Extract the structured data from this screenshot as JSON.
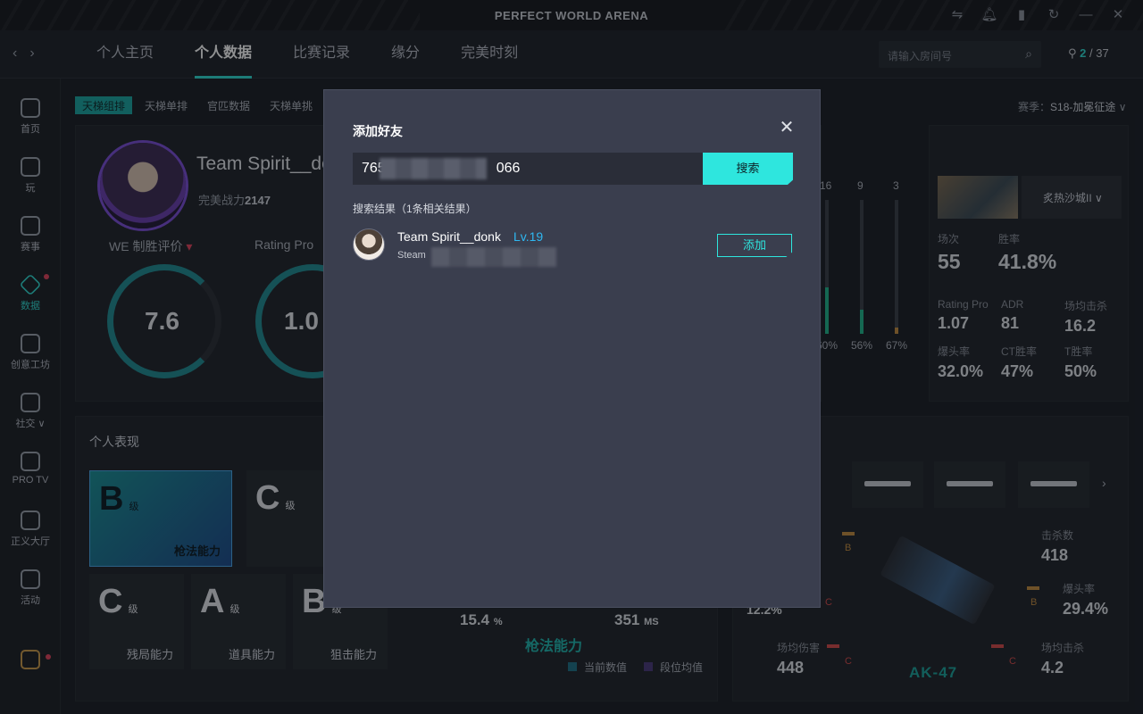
{
  "window": {
    "title": "PERFECT WORLD ARENA"
  },
  "nav": {
    "tabs": [
      "个人主页",
      "个人数据",
      "比赛记录",
      "缘分",
      "完美时刻"
    ],
    "room_search_placeholder": "请输入房间号",
    "online_current": "2",
    "online_total": "/ 37"
  },
  "sidebar": {
    "items": [
      "首页",
      "玩",
      "赛事",
      "数据",
      "创意工坊",
      "社交",
      "PRO TV",
      "正义大厅",
      "活动"
    ],
    "social_suffix": "∨"
  },
  "background": {
    "subtabs": [
      "天梯组排",
      "天梯单排",
      "官匹数据",
      "天梯单挑"
    ],
    "season_label": "赛季：",
    "season_value": "S18-加冕征途",
    "player_name": "Team Spirit__de",
    "power_label": "完美战力",
    "power_value": "2147",
    "we_label": "WE 制胜评价",
    "rating_label": "Rating Pro",
    "we_value": "7.6",
    "rating_value": "1.0",
    "section_title": "个人表现",
    "grades": [
      {
        "grade": "B",
        "unit": "级",
        "caption": "枪法能力"
      },
      {
        "grade": "C",
        "unit": "级",
        "caption": ""
      },
      {
        "grade": "C",
        "unit": "级",
        "caption": "残局能力"
      },
      {
        "grade": "A",
        "unit": "级",
        "caption": "道具能力"
      },
      {
        "grade": "B",
        "unit": "级",
        "caption": "狙击能力"
      }
    ],
    "mid_stats": {
      "v1": "15.4",
      "u1": "%",
      "v2": "351",
      "u2": "MS",
      "ability": "枪法能力",
      "legend_current": "当前数值",
      "legend_avg": "段位均值"
    },
    "bar_nums": [
      "16",
      "9",
      "3"
    ],
    "bar_pcts": [
      "60%",
      "56%",
      "67%"
    ],
    "bar_fill": [
      0.35,
      0.18,
      0.05
    ],
    "map_name": "炙热沙城II",
    "stats_big": [
      {
        "k": "场次",
        "v": "55"
      },
      {
        "k": "胜率",
        "v": "41.8%"
      }
    ],
    "stats": [
      {
        "k": "Rating Pro",
        "v": "1.07"
      },
      {
        "k": "ADR",
        "v": "81"
      },
      {
        "k": "场均击杀",
        "v": "16.2"
      },
      {
        "k": "爆头率",
        "v": "32.0%"
      },
      {
        "k": "CT胜率",
        "v": "47%"
      },
      {
        "k": "T胜率",
        "v": "50%"
      }
    ],
    "weapon_stats": [
      {
        "k": "击杀数",
        "v": "418"
      },
      {
        "k": "爆头率",
        "v": "29.4%"
      },
      {
        "k": "场均伤害",
        "v": "448"
      },
      {
        "k": "场均击杀",
        "v": "4.2"
      }
    ],
    "weapon_grades": [
      "B",
      "C",
      "B",
      "C",
      "C"
    ],
    "weapon_name": "AK-47",
    "weapon_left_val": "12.2%"
  },
  "modal": {
    "title": "添加好友",
    "input_value": "765",
    "input_tail": "066",
    "search_label": "搜索",
    "result_header": "搜索结果（1条相关结果）",
    "result": {
      "name": "Team Spirit__donk",
      "level": "Lv.19",
      "platform": "Steam",
      "action_label": "添加"
    }
  },
  "colors": {
    "accent": "#2ee6de",
    "level": "#2fb7f0",
    "modal_bg": "#3a3e4e",
    "alert": "#e0425b"
  }
}
